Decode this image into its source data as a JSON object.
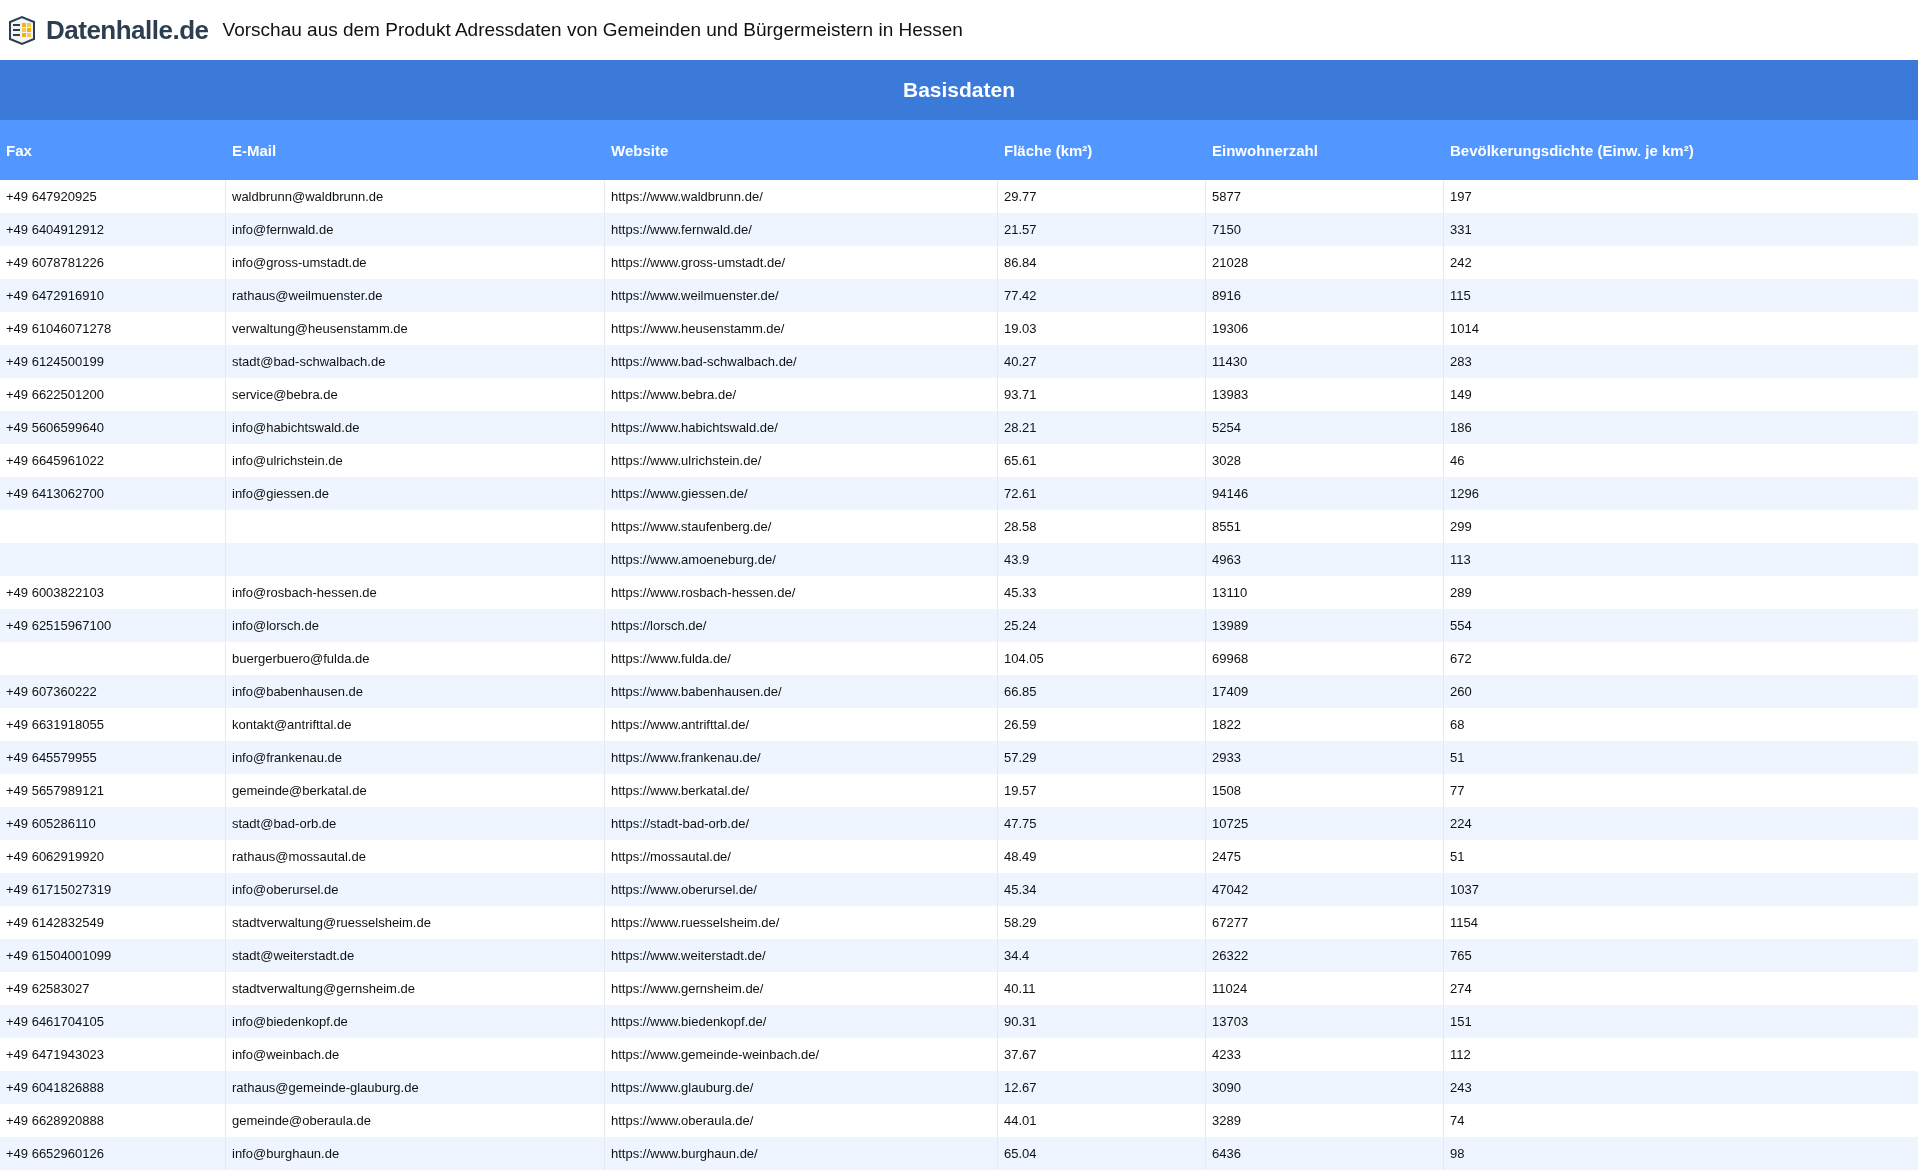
{
  "header": {
    "logo": "Datenhalle.de",
    "title": "Vorschau aus dem Produkt Adressdaten von Gemeinden und Bürgermeistern in Hessen"
  },
  "table": {
    "group_title": "Basisdaten",
    "columns": [
      "Fax",
      "E-Mail",
      "Website",
      "Fläche (km²)",
      "Einwohnerzahl",
      "Bevölkerungsdichte (Einw. je km²)"
    ],
    "rows": [
      [
        "+49 647920925",
        "waldbrunn@waldbrunn.de",
        "https://www.waldbrunn.de/",
        "29.77",
        "5877",
        "197"
      ],
      [
        "+49 6404912912",
        "info@fernwald.de",
        "https://www.fernwald.de/",
        "21.57",
        "7150",
        "331"
      ],
      [
        "+49 6078781226",
        "info@gross-umstadt.de",
        "https://www.gross-umstadt.de/",
        "86.84",
        "21028",
        "242"
      ],
      [
        "+49 6472916910",
        "rathaus@weilmuenster.de",
        "https://www.weilmuenster.de/",
        "77.42",
        "8916",
        "115"
      ],
      [
        "+49 61046071278",
        "verwaltung@heusenstamm.de",
        "https://www.heusenstamm.de/",
        "19.03",
        "19306",
        "1014"
      ],
      [
        "+49 6124500199",
        "stadt@bad-schwalbach.de",
        "https://www.bad-schwalbach.de/",
        "40.27",
        "11430",
        "283"
      ],
      [
        "+49 6622501200",
        "service@bebra.de",
        "https://www.bebra.de/",
        "93.71",
        "13983",
        "149"
      ],
      [
        "+49 5606599640",
        "info@habichtswald.de",
        "https://www.habichtswald.de/",
        "28.21",
        "5254",
        "186"
      ],
      [
        "+49 6645961022",
        "info@ulrichstein.de",
        "https://www.ulrichstein.de/",
        "65.61",
        "3028",
        "46"
      ],
      [
        "+49 6413062700",
        "info@giessen.de",
        "https://www.giessen.de/",
        "72.61",
        "94146",
        "1296"
      ],
      [
        null,
        null,
        "https://www.staufenberg.de/",
        "28.58",
        "8551",
        "299"
      ],
      [
        null,
        null,
        "https://www.amoeneburg.de/",
        "43.9",
        "4963",
        "113"
      ],
      [
        "+49 6003822103",
        "info@rosbach-hessen.de",
        "https://www.rosbach-hessen.de/",
        "45.33",
        "13110",
        "289"
      ],
      [
        "+49 62515967100",
        "info@lorsch.de",
        "https://lorsch.de/",
        "25.24",
        "13989",
        "554"
      ],
      [
        null,
        "buergerbuero@fulda.de",
        "https://www.fulda.de/",
        "104.05",
        "69968",
        "672"
      ],
      [
        "+49 607360222",
        "info@babenhausen.de",
        "https://www.babenhausen.de/",
        "66.85",
        "17409",
        "260"
      ],
      [
        "+49 6631918055",
        "kontakt@antrifttal.de",
        "https://www.antrifttal.de/",
        "26.59",
        "1822",
        "68"
      ],
      [
        "+49 645579955",
        "info@frankenau.de",
        "https://www.frankenau.de/",
        "57.29",
        "2933",
        "51"
      ],
      [
        "+49 5657989121",
        "gemeinde@berkatal.de",
        "https://www.berkatal.de/",
        "19.57",
        "1508",
        "77"
      ],
      [
        "+49 605286110",
        "stadt@bad-orb.de",
        "https://stadt-bad-orb.de/",
        "47.75",
        "10725",
        "224"
      ],
      [
        "+49 6062919920",
        "rathaus@mossautal.de",
        "https://mossautal.de/",
        "48.49",
        "2475",
        "51"
      ],
      [
        "+49 61715027319",
        "info@oberursel.de",
        "https://www.oberursel.de/",
        "45.34",
        "47042",
        "1037"
      ],
      [
        "+49 6142832549",
        "stadtverwaltung@ruesselsheim.de",
        "https://www.ruesselsheim.de/",
        "58.29",
        "67277",
        "1154"
      ],
      [
        "+49 61504001099",
        "stadt@weiterstadt.de",
        "https://www.weiterstadt.de/",
        "34.4",
        "26322",
        "765"
      ],
      [
        "+49 62583027",
        "stadtverwaltung@gernsheim.de",
        "https://www.gernsheim.de/",
        "40.11",
        "11024",
        "274"
      ],
      [
        "+49 6461704105",
        "info@biedenkopf.de",
        "https://www.biedenkopf.de/",
        "90.31",
        "13703",
        "151"
      ],
      [
        "+49 6471943023",
        "info@weinbach.de",
        "https://www.gemeinde-weinbach.de/",
        "37.67",
        "4233",
        "112"
      ],
      [
        "+49 6041826888",
        "rathaus@gemeinde-glauburg.de",
        "https://www.glauburg.de/",
        "12.67",
        "3090",
        "243"
      ],
      [
        "+49 6628920888",
        "gemeinde@oberaula.de",
        "https://www.oberaula.de/",
        "44.01",
        "3289",
        "74"
      ],
      [
        "+49 6652960126",
        "info@burghaun.de",
        "https://www.burghaun.de/",
        "65.04",
        "6436",
        "98"
      ]
    ]
  }
}
